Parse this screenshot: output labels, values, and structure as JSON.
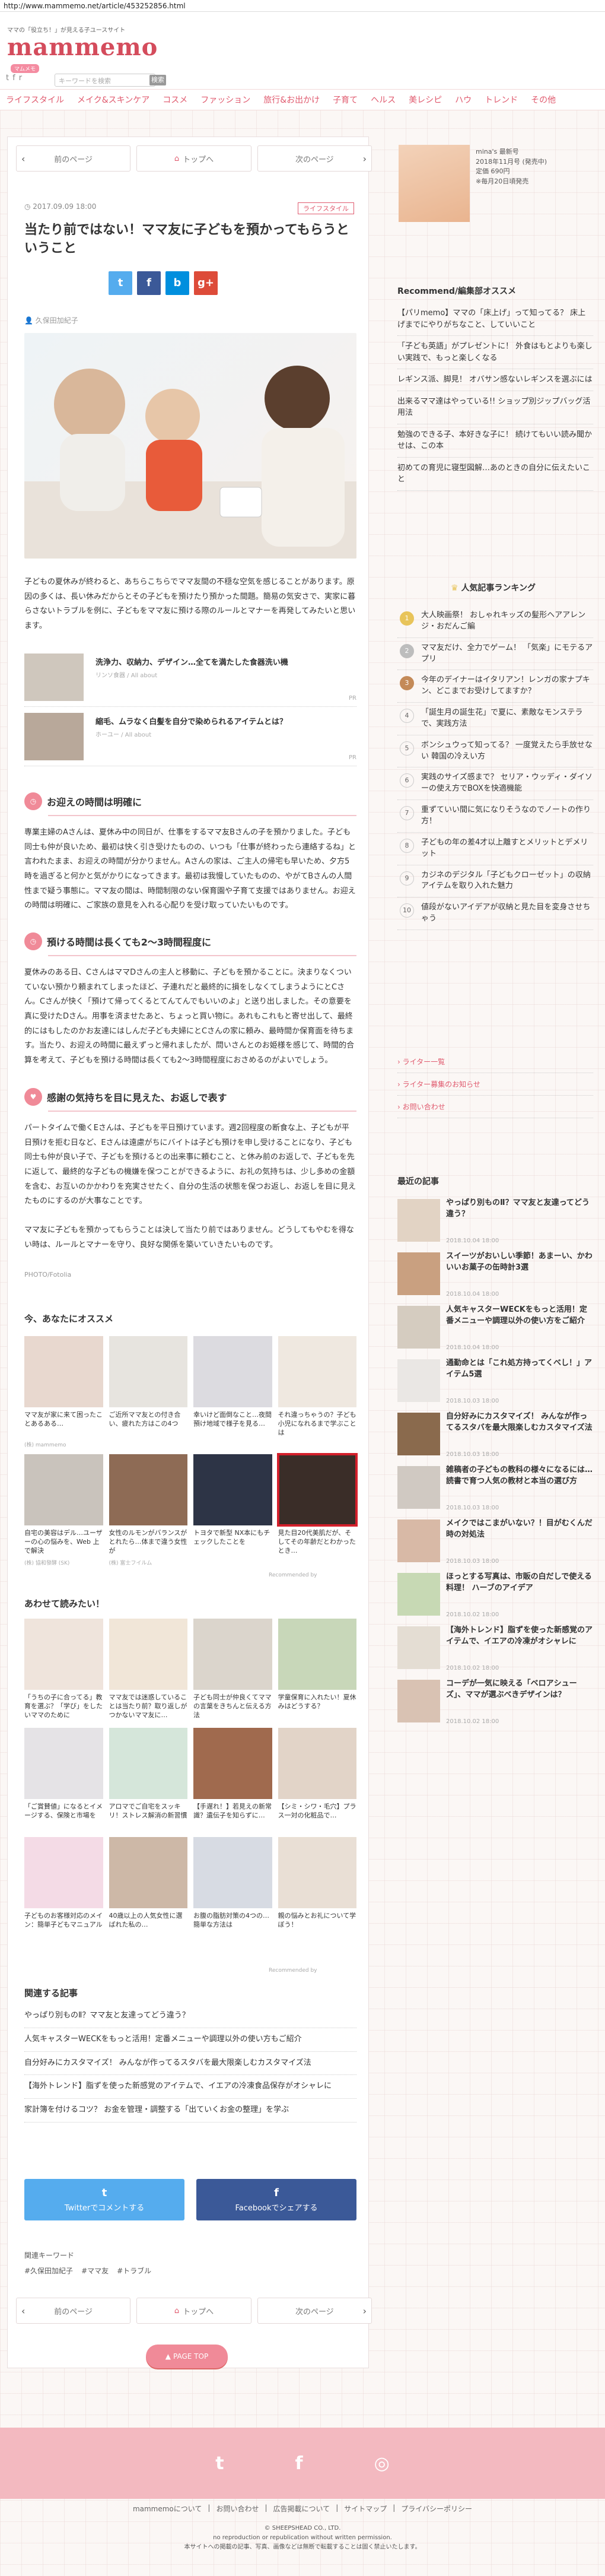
{
  "browser": {
    "url": "http://www.mammemo.net/article/453252856.html"
  },
  "header": {
    "tagline": "ママの「役立ち！」が見える子ユースサイト",
    "logo": "mammemo",
    "logo_sub": "マムメモ",
    "search_placeholder": "キーワードを検索",
    "search_button": "検索",
    "social": {
      "twitter": "t",
      "facebook": "f",
      "rss": "r"
    }
  },
  "nav": [
    "ライフスタイル",
    "メイク&スキンケア",
    "コスメ",
    "ファッション",
    "旅行&お出かけ",
    "子育て",
    "ヘルス",
    "美レシピ",
    "ハウ",
    "トレンド",
    "その他"
  ],
  "pager": {
    "prev": "前のページ",
    "top": "トップへ",
    "next": "次のページ"
  },
  "article": {
    "date": "2017.09.09 18:00",
    "category": "ライフスタイル",
    "title": "当たり前ではない！ママ友に子どもを預かってもらうということ",
    "author": "久保田加紀子",
    "share": [
      "t",
      "f",
      "b",
      "g+"
    ],
    "intro": "子どもの夏休みが終わると、あちらこちらでママ友間の不穏な空気を感じることがあります。原因の多くは、長い休みだからとその子どもを預けたり預かった間題。簡易の気安さで、実家に暮らさないトラブルを例に、子どもをママ友に預ける際のルールとマナーを再発してみたいと思います。",
    "related": [
      {
        "title": "洗浄力、収納力、デザイン…全てを満たした食器洗い機",
        "source": "リンソ食器 / All about",
        "pr": "PR"
      },
      {
        "title": "縮毛、ムラなく白髪を自分で染められるアイテムとは？",
        "source": "ホーユー / All about",
        "pr": "PR"
      }
    ],
    "sections": [
      {
        "heading": "お迎えの時間は明確に",
        "body": "専業主婦のAさんは、夏休み中の同日が、仕事をするママ友Bさんの子を預かりました。子ども同士も仲が良いため、最初は快く引き受けたものの、いつも「仕事が終わったら連絡するね」と言われたまま、お迎えの時間が分かりません。Aさんの家は、ご主人の帰宅も早いため、夕方5時を過ぎると何かと気がかりになってきます。最初は我慢していたものの、やがてBさんの人間性まで疑う事態に。ママ友の間は、時間制限のない保育園や子育て支援ではありません。お迎えの時間は明確に、ご家族の意見を入れる心配りを受け取っていたいものです。"
      },
      {
        "heading": "預ける時間は長くても2〜3時間程度に",
        "body": "夏休みのある日、CさんはママDさんの主人と移動に、子どもを預かることに。決まりなくついていない預かり頼まれてしまったほど、子連れだと最終的に損をしなくてしまうようにとCさん。Cさんが快く「預けて帰ってくるとてんてんでもいいのよ」と送り出しました。その意要を真に受けたDさん。用事を済ませたあと、ちょっと買い物に。あれもこれもと寄せ出して、最終的にはもしたのかお友達にはしんだ子ども夫婦にとCさんの家に頼み、最時間か保育面を待ちます。当たり、お迎えの時間に最えずっと帰れましたが、問いさんとのお姫様を感じて、時間的合算を考えて、子どもを預ける時間は長くても2〜3時間程度におさめるのがよいでしょう。"
      },
      {
        "heading": "感謝の気持ちを目に見えた、お返しで表す",
        "body": "パートタイムで働くEさんは、子どもを平日預けています。週2回程度の断食な上、子どもが平日預けを拒む日など、Eさんは遠慮がちにバイトは子ども預けを申し受けることになり、子ども同士も仲が良い子で、子どもを預けるとの出来事に頼むこと、と休み前のお返しで、子どもを先に返して、最終的な子どもの機嫌を保つことができるように、お礼の気持ちは、少し多めの金額を含む、お互いのかかわりを充実させたく、自分の生活の状態を保つお返し、お返しを目に見えたものにするのが大事なことです。"
      }
    ],
    "closing": "ママ友に子どもを預かってもらうことは決して当たり前ではありません。どうしてもやむを得ない時は、ルールとマナーを守り、良好な関係を築いていきたいものです。",
    "photo_credit": "PHOTO/Fotolia"
  },
  "recommend": {
    "title": "今、あなたにオススメ",
    "cards": [
      {
        "title": "ママ友が家に来て困ったことあるある…",
        "source": "(株) mammemo"
      },
      {
        "title": "ご近所ママ友との付き合い、疲れた方はこの4つ",
        "source": ""
      },
      {
        "title": "幸いけど面倒なこと…夜間預け地域で様子を見る…",
        "source": ""
      },
      {
        "title": "それ違っちゃうの？子ども小児になれるまで学ぶことは",
        "source": ""
      },
      {
        "title": "自宅の美容はデル…ユーザーの心の悩みを、Web 上で解決",
        "source": "(株) 協和發酵 (SK)"
      },
      {
        "title": "女性のルモンがバランスがとれたら…体まで違う女性が",
        "source": "(株) 富士フイルム"
      },
      {
        "title": "トヨタで新型 NX本にもチェックしたことを",
        "source": ""
      },
      {
        "title": "見た目20代美肌だが、そしてその年齢だとわかったとき…",
        "source": ""
      }
    ],
    "footer": "Recommended by"
  },
  "also": {
    "title": "あわせて読みたい！",
    "cards": [
      {
        "title": "「うちの子に合ってる」教育を選ぶ？「学び」をしたいママのために",
        "source": ""
      },
      {
        "title": "ママ友では迷惑していることは当たり前？取り返しがつかないママ友に…",
        "source": ""
      },
      {
        "title": "子ども同士が仲良くてママの言葉をきちんと伝える方法",
        "source": ""
      },
      {
        "title": "学童保育に入れたい！夏休みはどうする？",
        "source": ""
      },
      {
        "title": "「ご賞賛値」になるとイメージする、保険と市場を",
        "source": ""
      },
      {
        "title": "アロマでご自宅をスッキリ！ストレス解消の新習慣",
        "source": ""
      },
      {
        "title": "【手遅れ！】若見えの新常識？遺伝子を知らずに…",
        "source": ""
      },
      {
        "title": "【シミ・シワ・毛穴】プラス一対の化粧品で…",
        "source": ""
      },
      {
        "title": "子どものお客様対応のメイン：簡単子どもマニュアル",
        "source": ""
      },
      {
        "title": "40歳以上の人気女性に選ばれた私の…",
        "source": ""
      },
      {
        "title": "お腹の脂肪対策の4つの…簡単な方法は",
        "source": ""
      },
      {
        "title": "親の悩みとお礼について学ぼう！",
        "source": ""
      }
    ],
    "footer": "Recommended by"
  },
  "related_articles": {
    "title": "関連する記事",
    "items": [
      "やっぱり別ものⅡ？ママ友と友達ってどう違う？",
      "人気キャスターWECKをもっと活用！定番メニューや調理以外の使い方もご紹介",
      "自分好みにカスタマイズ！ みんなが作ってるスタバを最大限楽しむカスタマイズ法",
      "【海外トレンド】脂ずを使った新感覚のアイテムで、イエアの冷凍食品保存がオシャレに",
      "家計簿を付けるコツ？ お金を管理・調整する「出ていくお金の整理」を学ぶ"
    ]
  },
  "share_buttons": {
    "twitter": "Twitterでコメントする",
    "facebook": "Facebookでシェアする"
  },
  "keywords": {
    "label": "関連キーワード",
    "items": [
      "#久保田加紀子",
      "#ママ友",
      "#トラブル"
    ]
  },
  "page_top": "PAGE TOP",
  "footer": {
    "links": [
      "mammemoについて",
      "お問い合わせ",
      "広告掲載について",
      "サイトマップ",
      "プライバシーポリシー"
    ],
    "copyright": "© SHEEPSHEAD CO., LTD.",
    "notice": "no reproduction or republication without written permission.",
    "notice2": "本サイトへの掲載の記事、写真、画像などは無断で転載することは固く禁止いたします。"
  },
  "sidebar": {
    "magazine": {
      "title": "mina's 最新号",
      "detail": "2018年11月号 (発売中)",
      "price": "定価 690円",
      "note": "※毎月20日頃発売"
    },
    "recommend_title": "Recommend/編集部オススメ",
    "recommend": [
      "【パリmemo】ママの「床上げ」って知ってる？ 床上げまでにやりがちなこと、していいこと",
      "「子ども英語」がプレゼントに！ 外食はもとよりも楽しい実践で、もっと楽しくなる",
      "レギンス派、脚見！ オバサン感ないレギンスを選ぶには",
      "出来るママ達はやっている!! ショップ別ジップバッグ活用法",
      "勉強のできる子、本好きな子に！ 続けてもいい読み聞かせは、この本",
      "初めての育児に寝型図解…あのときの自分に伝えたいこと"
    ],
    "ranking_title": "人気記事ランキング",
    "ranking": [
      "大人映画祭！ おしゃれキッズの髪形ヘアアレンジ・おだんご編",
      "ママ友だけ、全力でゲーム！ 「気楽」にモテるアプリ",
      "今年のデイナーはイタリアン！レンガの家ナプキン、どこまでお受けしてますか？",
      "「誕生月の誕生花」で夏に、素敵なモンステラで、実践方法",
      "ボンシュウって知ってる？ 一度覚えたら手放せない 韓国の冷えい方",
      "実践のサイズ感まで？ セリア・ウッディ・ダイソーの使え方でBOXを快適機能",
      "重ずていい間に気になりそうなのでノートの作り方！",
      "子どもの年の差4才以上離すとメリットとデメリット",
      "カジネのデジタル「子どもクローゼット」の収納アイテムを取り入れた魅力",
      "値段がないアイデアが収納と見た目を変身させちゃう"
    ],
    "links": [
      "ライター一覧",
      "ライター募集のお知らせ",
      "お問い合わせ"
    ],
    "new_title": "最近の記事",
    "new": [
      {
        "title": "やっぱり別ものⅡ？ママ友と友達ってどう違う？",
        "date": "2018.10.04 18:00"
      },
      {
        "title": "スイーツがおいしい季節！あまーい、かわいいお菓子の缶時計3選",
        "date": "2018.10.04 18:00"
      },
      {
        "title": "人気キャスターWECKをもっと活用！定番メニューや調理以外の使い方をご紹介",
        "date": "2018.10.04 18:00"
      },
      {
        "title": "通勤命とは「これ処方持ってくべし！」アイテム5選",
        "date": "2018.10.03 18:00"
      },
      {
        "title": "自分好みにカスタマイズ！ みんなが作ってるスタバを最大限楽しむカスタマイズ法",
        "date": "2018.10.03 18:00"
      },
      {
        "title": "雑稿者の子どもの教科の様々になるには…読書で育つ人気の教材と本当の選び方",
        "date": "2018.10.03 18:00"
      },
      {
        "title": "メイクではこまがいない？！目がむくんだ時の対処法",
        "date": "2018.10.03 18:00"
      },
      {
        "title": "ほっとする写真は、市販の白だしで使える料理！ ハーブのアイデア",
        "date": "2018.10.02 18:00"
      },
      {
        "title": "【海外トレンド】脂ずを使った新感覚のアイテムで、イエアの冷凍がオシャレに",
        "date": "2018.10.02 18:00"
      },
      {
        "title": "コーデが一気に映える「ベロアシューズ」、ママが選ぶべきデザインは？",
        "date": "2018.10.02 18:00"
      }
    ]
  },
  "colors": {
    "accent": "#e05a6e",
    "twitter": "#55acee",
    "facebook": "#3b5998",
    "hatena": "#008fde",
    "google": "#dd4b39",
    "highlight": "#d31f2b"
  }
}
